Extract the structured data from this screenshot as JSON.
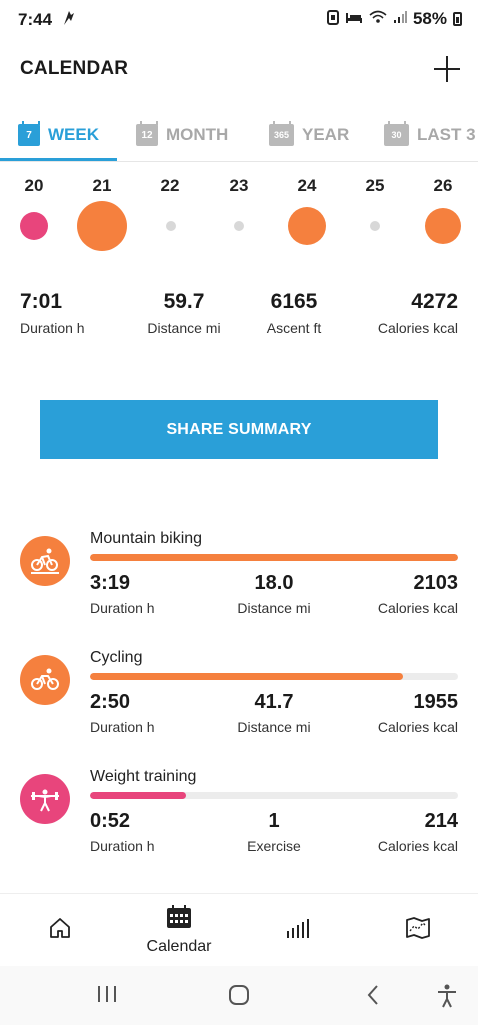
{
  "status_bar": {
    "time": "7:44",
    "battery": "58%"
  },
  "header": {
    "title": "CALENDAR"
  },
  "tabs": [
    {
      "label": "WEEK",
      "icon_text": "7",
      "active": true
    },
    {
      "label": "MONTH",
      "icon_text": "12",
      "active": false
    },
    {
      "label": "YEAR",
      "icon_text": "365",
      "active": false
    },
    {
      "label": "LAST 3",
      "icon_text": "30",
      "active": false
    }
  ],
  "days": [
    {
      "label": "20",
      "dot": "pink-medium"
    },
    {
      "label": "21",
      "dot": "orange-large"
    },
    {
      "label": "22",
      "dot": "gray-small"
    },
    {
      "label": "23",
      "dot": "gray-small"
    },
    {
      "label": "24",
      "dot": "orange-medium"
    },
    {
      "label": "25",
      "dot": "gray-small"
    },
    {
      "label": "26",
      "dot": "orange-medium"
    }
  ],
  "summary": {
    "duration_value": "7:01",
    "duration_label": "Duration h",
    "distance_value": "59.7",
    "distance_label": "Distance mi",
    "ascent_value": "6165",
    "ascent_label": "Ascent ft",
    "calories_value": "4272",
    "calories_label": "Calories kcal"
  },
  "share_button": "SHARE SUMMARY",
  "activities": [
    {
      "name": "Mountain biking",
      "icon": "mountain-bike-icon",
      "color": "#f5803e",
      "progress": 1.0,
      "duration_value": "3:19",
      "duration_label": "Duration h",
      "mid_value": "18.0",
      "mid_label": "Distance mi",
      "calories_value": "2103",
      "calories_label": "Calories kcal"
    },
    {
      "name": "Cycling",
      "icon": "bicycle-icon",
      "color": "#f5803e",
      "progress": 0.85,
      "duration_value": "2:50",
      "duration_label": "Duration h",
      "mid_value": "41.7",
      "mid_label": "Distance mi",
      "calories_value": "1955",
      "calories_label": "Calories kcal"
    },
    {
      "name": "Weight training",
      "icon": "weightlifting-icon",
      "color": "#e8457c",
      "progress": 0.26,
      "duration_value": "0:52",
      "duration_label": "Duration h",
      "mid_value": "1",
      "mid_label": "Exercise",
      "calories_value": "214",
      "calories_label": "Calories kcal"
    }
  ],
  "bottom_nav": {
    "home_icon": "home-icon",
    "calendar_label": "Calendar",
    "stats_icon": "bar-chart-icon",
    "map_icon": "map-icon"
  },
  "colors": {
    "accent": "#2a9fd8",
    "orange": "#f5803e",
    "pink": "#e8457c",
    "gray_dot": "#d8d8d8"
  }
}
